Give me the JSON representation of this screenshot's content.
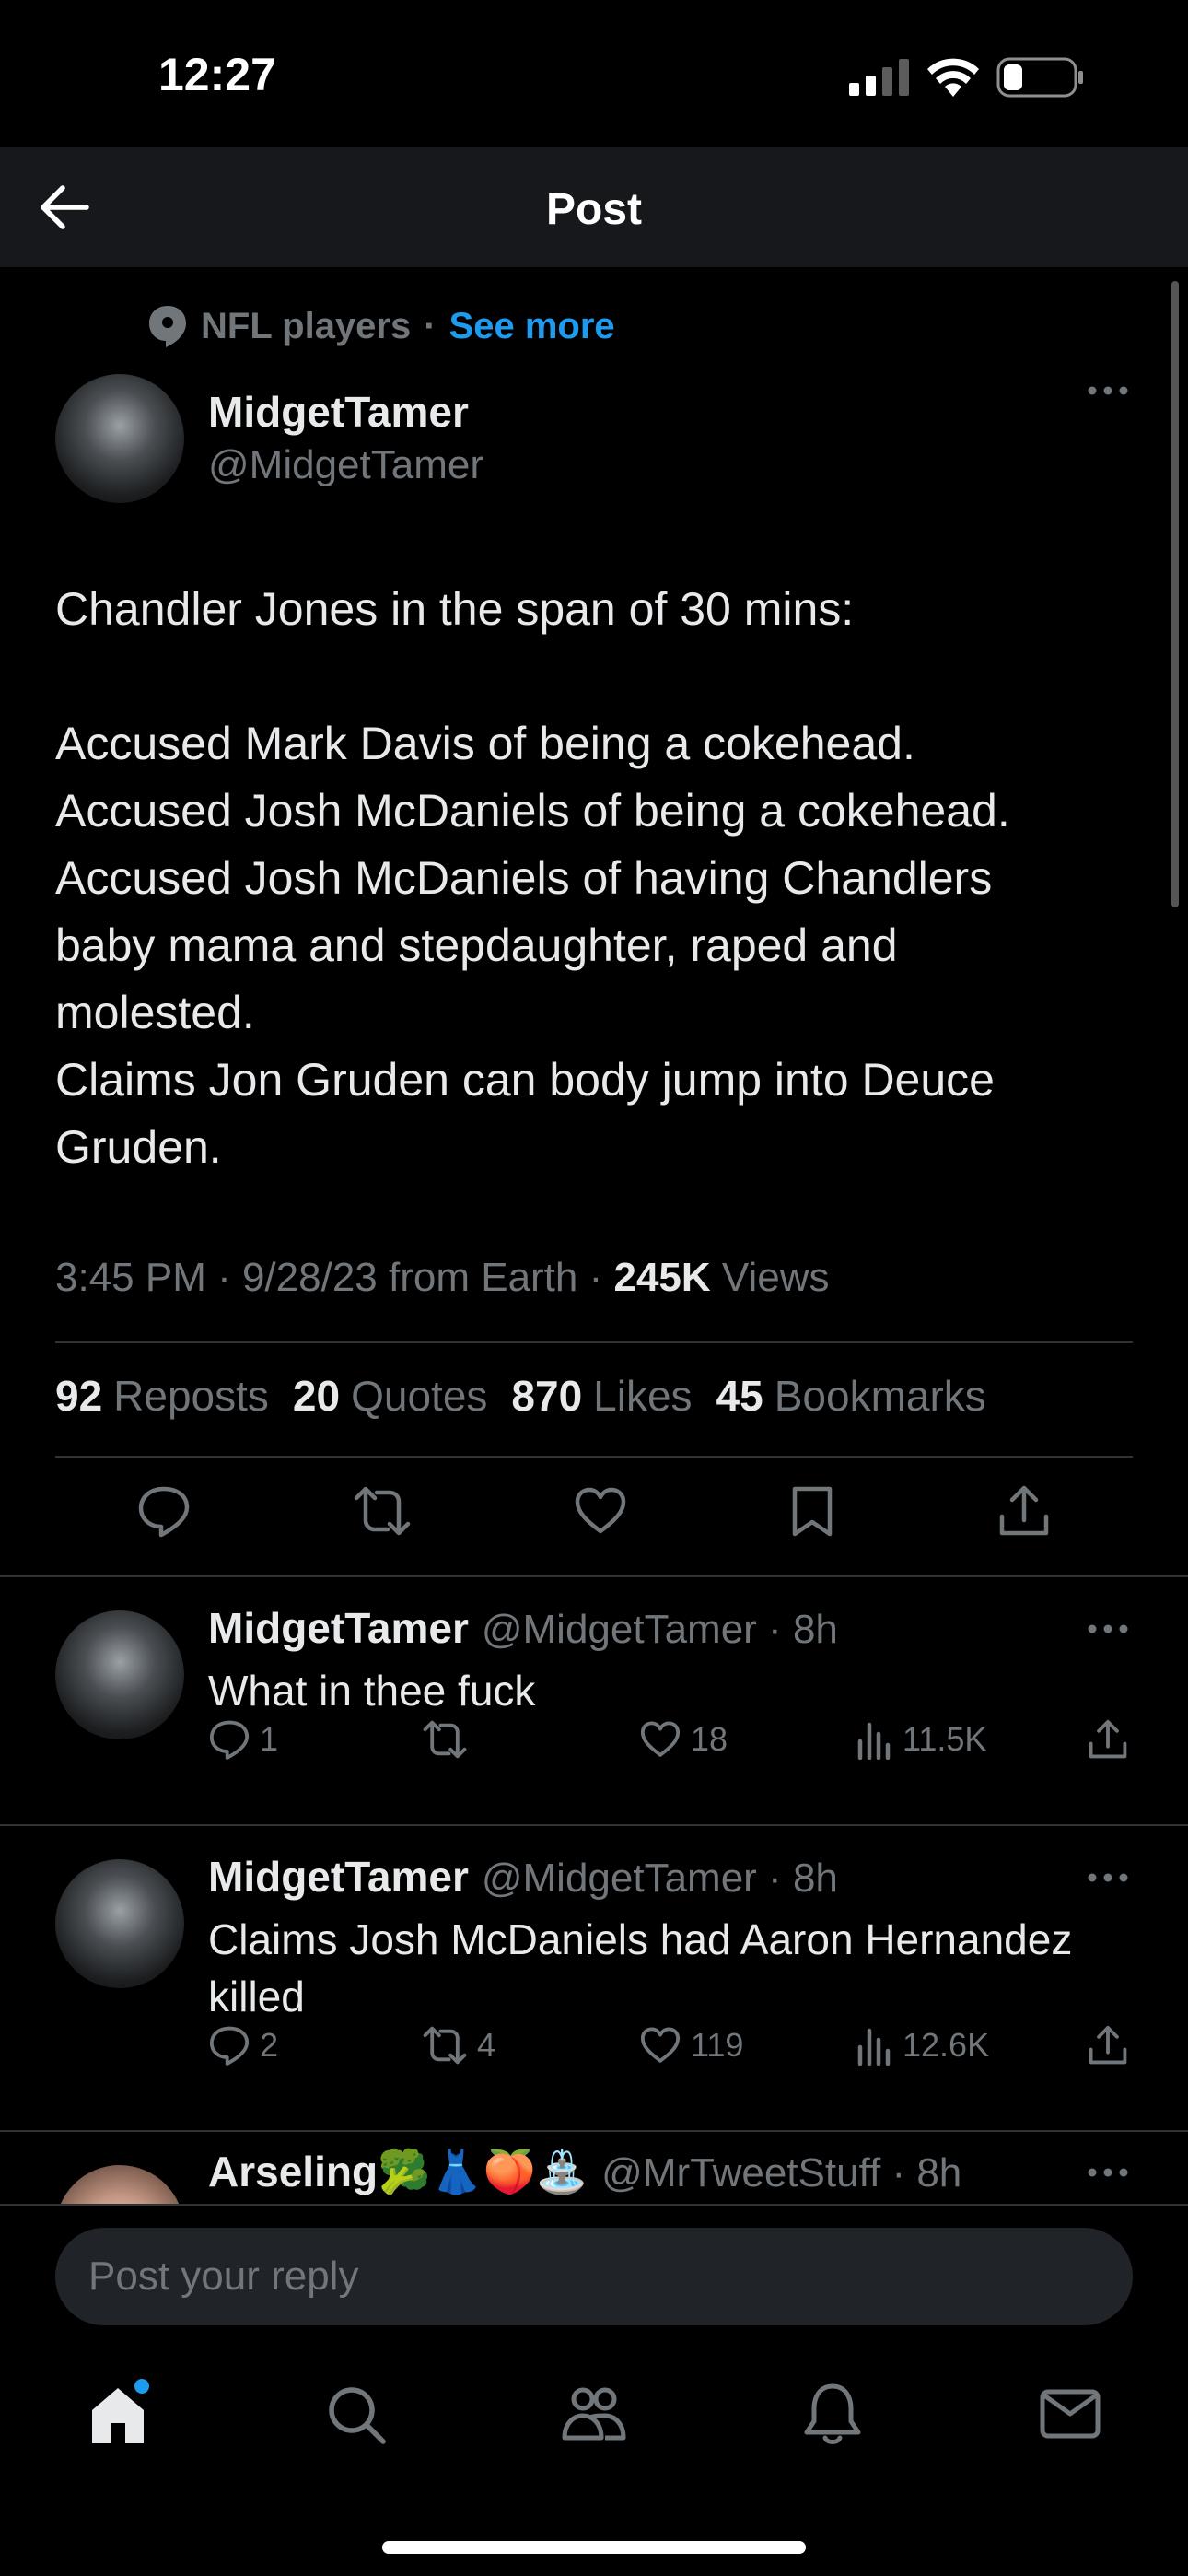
{
  "status_bar": {
    "time": "12:27"
  },
  "header": {
    "title": "Post"
  },
  "context": {
    "label": "NFL players",
    "separator": "·",
    "link": "See more"
  },
  "author": {
    "name": "MidgetTamer",
    "handle": "@MidgetTamer"
  },
  "post": {
    "text": "Chandler Jones in the span of 30 mins:\n\nAccused Mark Davis of being a cokehead.\nAccused Josh McDaniels of being a cokehead.\nAccused Josh McDaniels of having Chandlers\nbaby mama and stepdaughter, raped and\nmolested.\nClaims Jon Gruden can body jump into Deuce\nGruden.",
    "time": "3:45 PM · 9/28/23 from Earth · ",
    "views_count": "245K",
    "views_label": " Views"
  },
  "stats": {
    "reposts_count": "92",
    "reposts_label": "Reposts",
    "quotes_count": "20",
    "quotes_label": "Quotes",
    "likes_count": "870",
    "likes_label": "Likes",
    "bookmarks_count": "45",
    "bookmarks_label": "Bookmarks"
  },
  "replies": [
    {
      "name": "MidgetTamer",
      "meta": "@MidgetTamer · 8h",
      "text": "What in thee fuck",
      "replies": "1",
      "reposts": "",
      "likes": "18",
      "views": "11.5K"
    },
    {
      "name": "MidgetTamer",
      "meta": "@MidgetTamer · 8h",
      "text": "Claims Josh McDaniels had Aaron Hernandez\nkilled",
      "replies": "2",
      "reposts": "4",
      "likes": "119",
      "views": "12.6K"
    },
    {
      "name": "Arseling🥦👗🍑⛲",
      "meta": "@MrTweetStuff · 8h"
    }
  ],
  "reply_input": {
    "placeholder": "Post your reply"
  },
  "colors": {
    "accent": "#1d9bf0",
    "background": "#000000",
    "text_secondary": "#71767b"
  }
}
